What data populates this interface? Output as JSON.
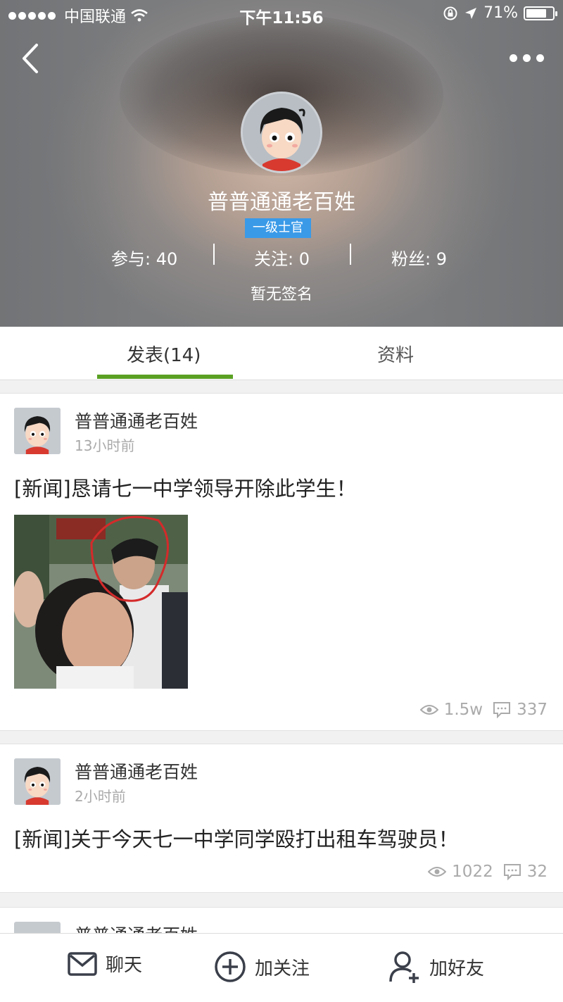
{
  "status_bar": {
    "carrier": "中国联通",
    "time": "下午11:56",
    "battery": "71%"
  },
  "profile": {
    "name": "普普通通老百姓",
    "rank": "一级士官",
    "stats": {
      "participate_label": "参与: 40",
      "follow_label": "关注: 0",
      "fans_label": "粉丝: 9"
    },
    "signature": "暂无签名"
  },
  "tabs": [
    {
      "label": "发表(14)",
      "active": true
    },
    {
      "label": "资料",
      "active": false
    }
  ],
  "posts": [
    {
      "author": "普普通通老百姓",
      "time": "13小时前",
      "title": "[新闻]恳请七一中学领导开除此学生！",
      "views": "1.5w",
      "comments": "337",
      "has_image": true
    },
    {
      "author": "普普通通老百姓",
      "time": "2小时前",
      "title": "[新闻]关于今天七一中学同学殴打出租车驾驶员！",
      "views": "1022",
      "comments": "32",
      "has_image": false
    },
    {
      "author": "普普通通老百姓"
    }
  ],
  "bottom_bar": {
    "chat_label": "聊天",
    "follow_label": "加关注",
    "add_friend_label": "加好友"
  },
  "colors": {
    "tab_active": "#5aa123",
    "rank_badge": "#3a9ae8"
  }
}
